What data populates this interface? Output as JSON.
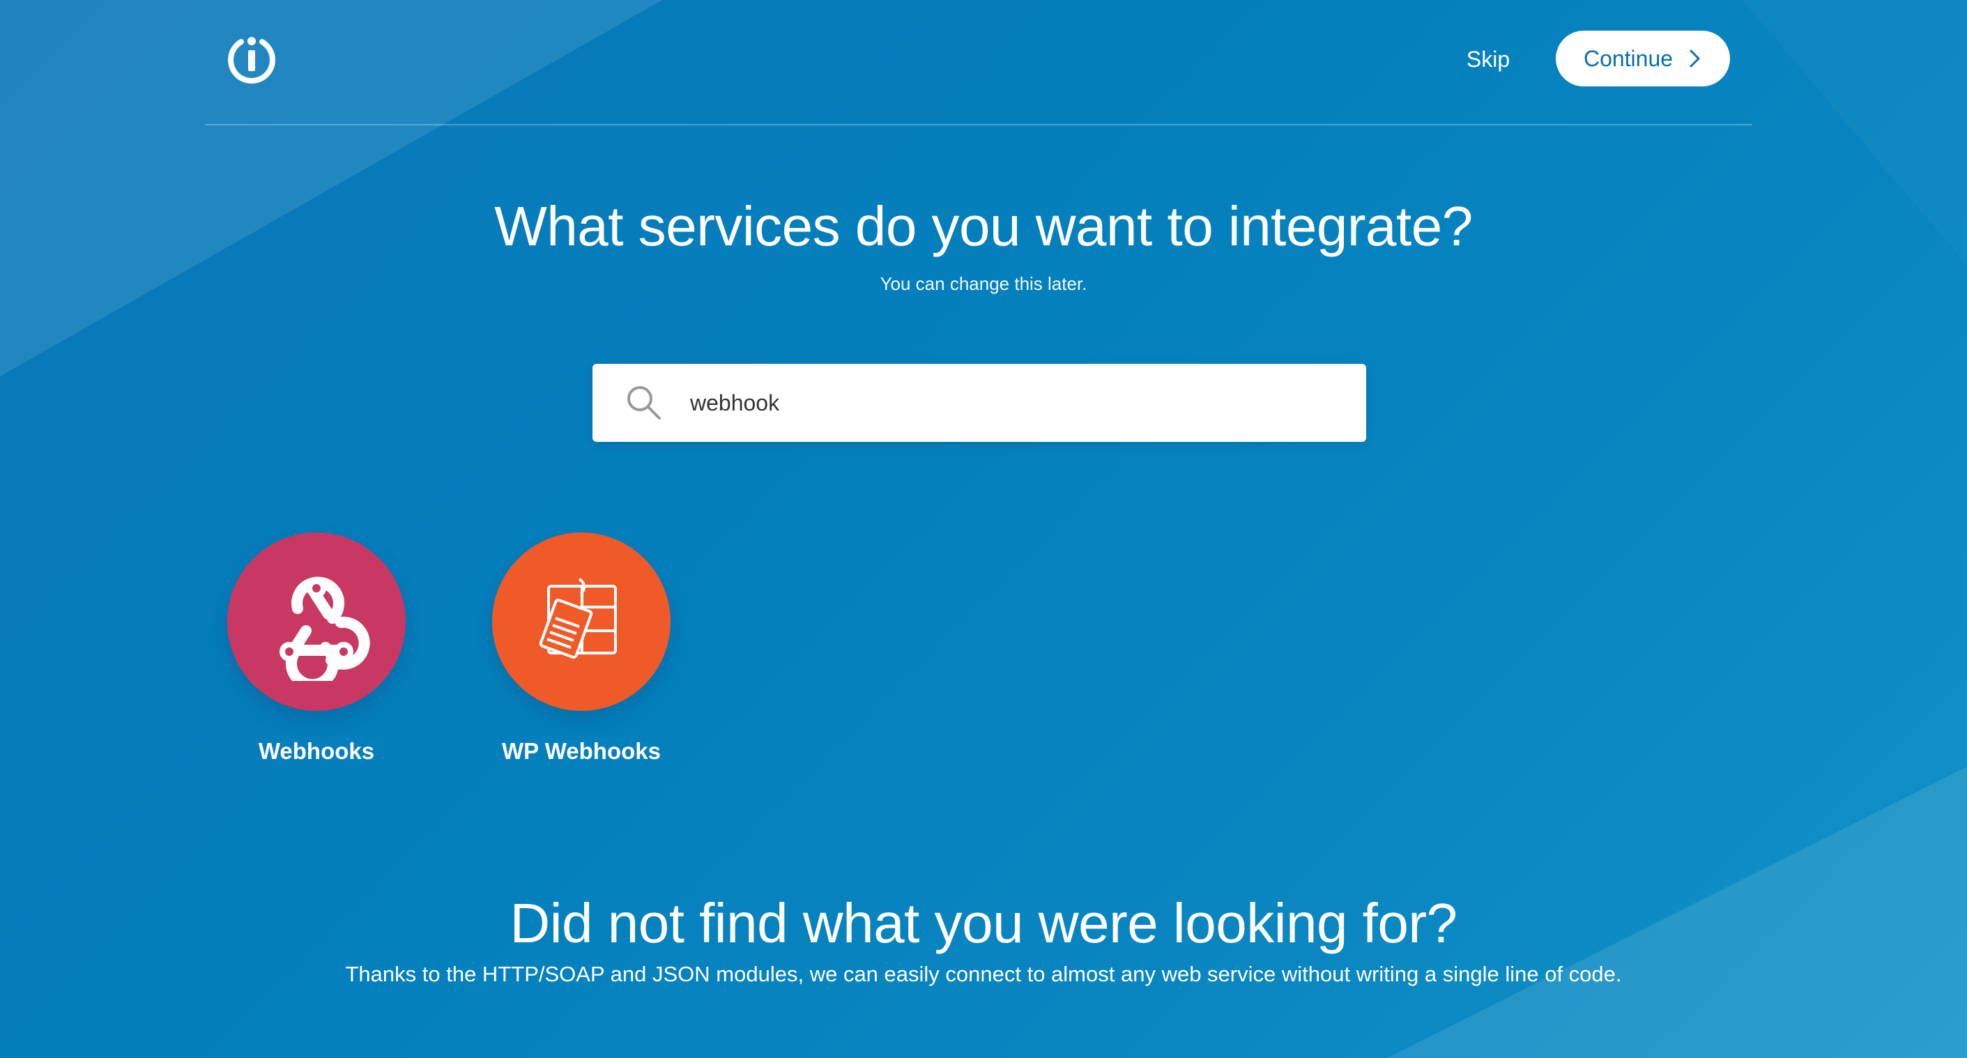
{
  "header": {
    "logo_icon": "integromat-logo-icon",
    "skip_label": "Skip",
    "continue_label": "Continue",
    "continue_icon": "chevron-right-icon"
  },
  "main": {
    "title": "What services do you want to integrate?",
    "subtitle": "You can change this later.",
    "search": {
      "icon": "search-icon",
      "value": "webhook",
      "placeholder": ""
    },
    "results": [
      {
        "label": "Webhooks",
        "icon": "webhook-icon",
        "color": "#c93862"
      },
      {
        "label": "WP Webhooks",
        "icon": "wp-webhooks-icon",
        "color": "#f05a28"
      }
    ]
  },
  "footer": {
    "title": "Did not find what you were looking for?",
    "text": "Thanks to the HTTP/SOAP and JSON modules, we can easily connect to almost any web service without writing a single line of code."
  },
  "colors": {
    "background": "#0480bd",
    "button_text": "#0b6ea8"
  }
}
